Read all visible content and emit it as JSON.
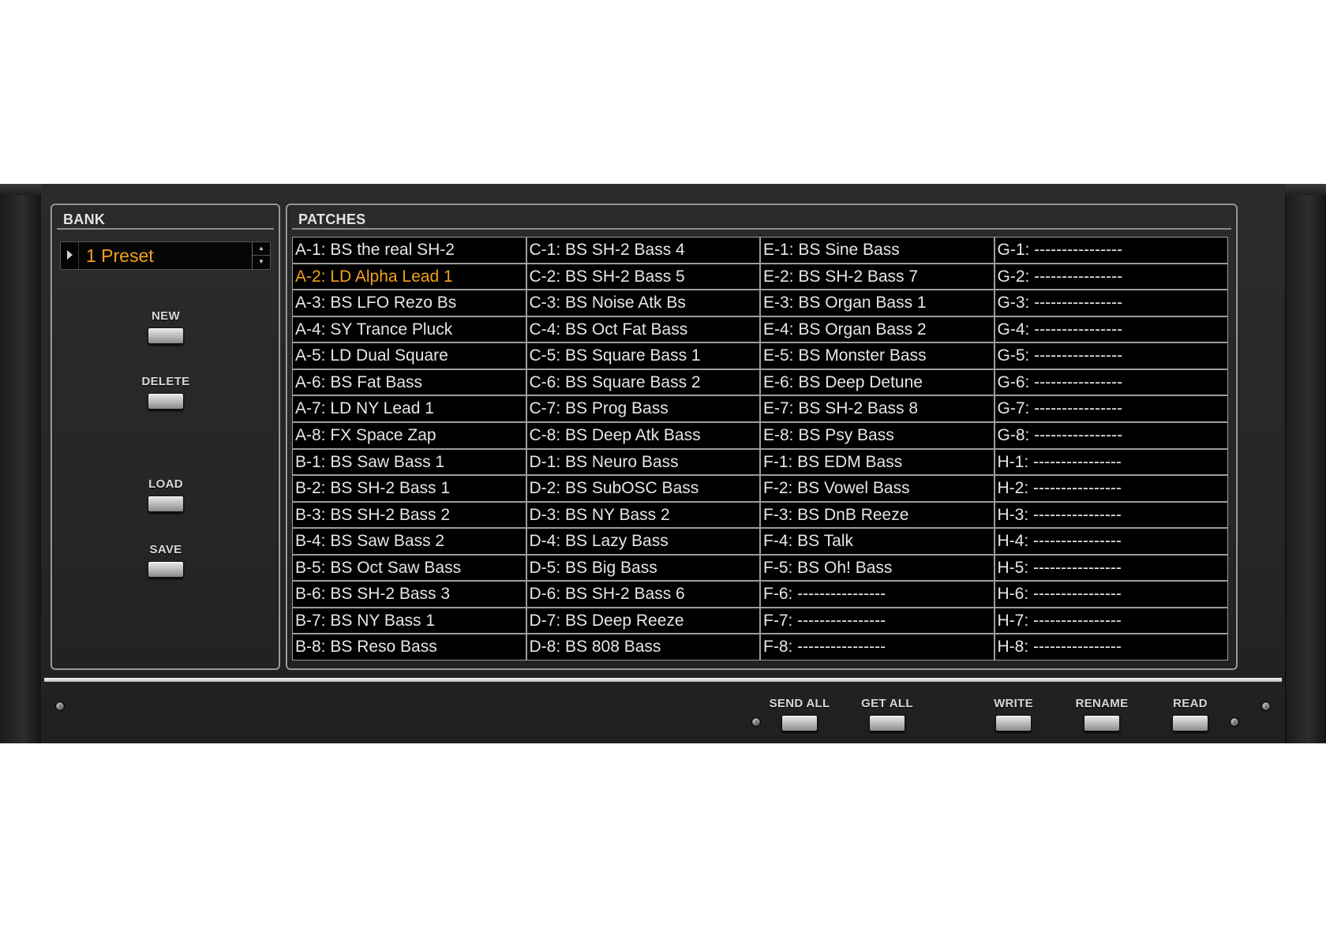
{
  "bank": {
    "title": "BANK",
    "selected": "1 Preset",
    "buttons": {
      "new": "NEW",
      "delete": "DELETE",
      "load": "LOAD",
      "save": "SAVE"
    }
  },
  "patches": {
    "title": "PATCHES",
    "selected_index": 1,
    "columns": [
      [
        "A-1: BS the real SH-2",
        "A-2: LD Alpha Lead 1",
        "A-3: BS LFO Rezo Bs",
        "A-4: SY Trance Pluck",
        "A-5: LD Dual Square",
        "A-6: BS Fat Bass",
        "A-7: LD NY Lead 1",
        "A-8: FX Space Zap",
        "B-1: BS Saw Bass 1",
        "B-2: BS SH-2 Bass 1",
        "B-3: BS SH-2 Bass 2",
        "B-4: BS Saw Bass 2",
        "B-5: BS Oct Saw Bass",
        "B-6: BS SH-2 Bass 3",
        "B-7: BS NY Bass 1",
        "B-8: BS Reso Bass"
      ],
      [
        "C-1: BS SH-2 Bass 4",
        "C-2: BS SH-2 Bass 5",
        "C-3: BS Noise Atk Bs",
        "C-4: BS Oct Fat Bass",
        "C-5: BS Square Bass 1",
        "C-6: BS Square Bass 2",
        "C-7: BS Prog Bass",
        "C-8: BS Deep Atk Bass",
        "D-1: BS Neuro Bass",
        "D-2: BS SubOSC Bass",
        "D-3: BS NY Bass 2",
        "D-4: BS Lazy Bass",
        "D-5: BS Big Bass",
        "D-6: BS SH-2 Bass 6",
        "D-7: BS Deep Reeze",
        "D-8: BS 808 Bass"
      ],
      [
        "E-1: BS Sine Bass",
        "E-2: BS SH-2 Bass 7",
        "E-3: BS Organ Bass 1",
        "E-4: BS Organ Bass 2",
        "E-5: BS Monster Bass",
        "E-6: BS Deep Detune",
        "E-7: BS SH-2 Bass 8",
        "E-8: BS Psy Bass",
        "F-1: BS EDM Bass",
        "F-2: BS Vowel Bass",
        "F-3: BS DnB Reeze",
        "F-4: BS Talk",
        "F-5: BS Oh! Bass",
        "F-6: ----------------",
        "F-7: ----------------",
        "F-8: ----------------"
      ],
      [
        "G-1: ----------------",
        "G-2: ----------------",
        "G-3: ----------------",
        "G-4: ----------------",
        "G-5: ----------------",
        "G-6: ----------------",
        "G-7: ----------------",
        "G-8: ----------------",
        "H-1: ----------------",
        "H-2: ----------------",
        "H-3: ----------------",
        "H-4: ----------------",
        "H-5: ----------------",
        "H-6: ----------------",
        "H-7: ----------------",
        "H-8: ----------------"
      ]
    ]
  },
  "footer": {
    "send_all": "SEND ALL",
    "get_all": "GET ALL",
    "write": "WRITE",
    "rename": "RENAME",
    "read": "READ"
  },
  "colors": {
    "accent": "#f2a020",
    "cell_text": "#e6e6e6",
    "cell_bg": "#000000"
  }
}
